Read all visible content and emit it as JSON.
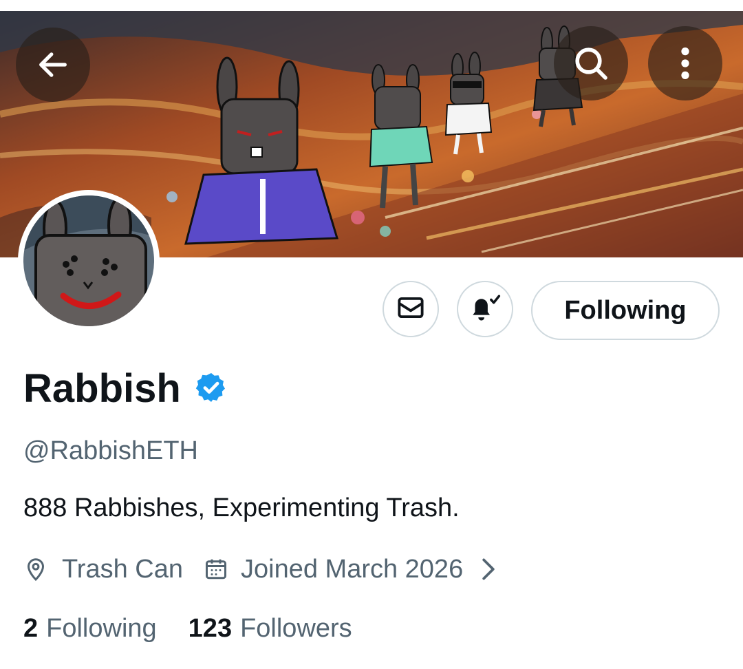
{
  "header": {
    "back_icon": "arrow-left-icon",
    "search_icon": "search-icon",
    "more_icon": "more-vertical-icon"
  },
  "actions": {
    "message_icon": "envelope-icon",
    "notification_icon": "bell-check-icon",
    "following_label": "Following"
  },
  "profile": {
    "display_name": "Rabbish",
    "verified": true,
    "handle": "@RabbishETH",
    "bio": "888 Rabbishes, Experimenting Trash.",
    "location": "Trash Can",
    "joined": "Joined March 2026"
  },
  "stats": {
    "following_count": "2",
    "following_label": "Following",
    "followers_count": "123",
    "followers_label": "Followers"
  },
  "colors": {
    "verified_blue": "#1d9bf0",
    "text_primary": "#0f1419",
    "text_secondary": "#536471",
    "border": "#cfd9de"
  }
}
